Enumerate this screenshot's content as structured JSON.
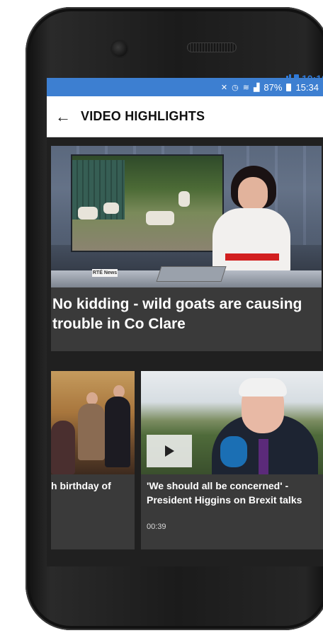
{
  "device_status": {
    "time": "10:10"
  },
  "status_bar": {
    "battery": "87%",
    "time": "15:34",
    "icons": [
      "mute-icon",
      "alarm-icon",
      "wifi-icon",
      "signal-icon"
    ]
  },
  "app_bar": {
    "back_icon": "arrow-left-icon",
    "title": "VIDEO HIGHLIGHTS"
  },
  "featured": {
    "title": "No kidding - wild goats are causing trouble in Co Clare",
    "thumbnail_badge": "RTÉ News"
  },
  "cards": [
    {
      "title": "h birthday of",
      "duration": ""
    },
    {
      "title": "'We should all be concerned' - President Higgins on Brexit talks",
      "duration": "00:39",
      "play_icon": "play-icon",
      "mic_label": "RTÉ"
    }
  ],
  "colors": {
    "status_bar": "#3d7fd1",
    "card_bg": "#3a3a3a",
    "screen_bg": "#202020"
  }
}
